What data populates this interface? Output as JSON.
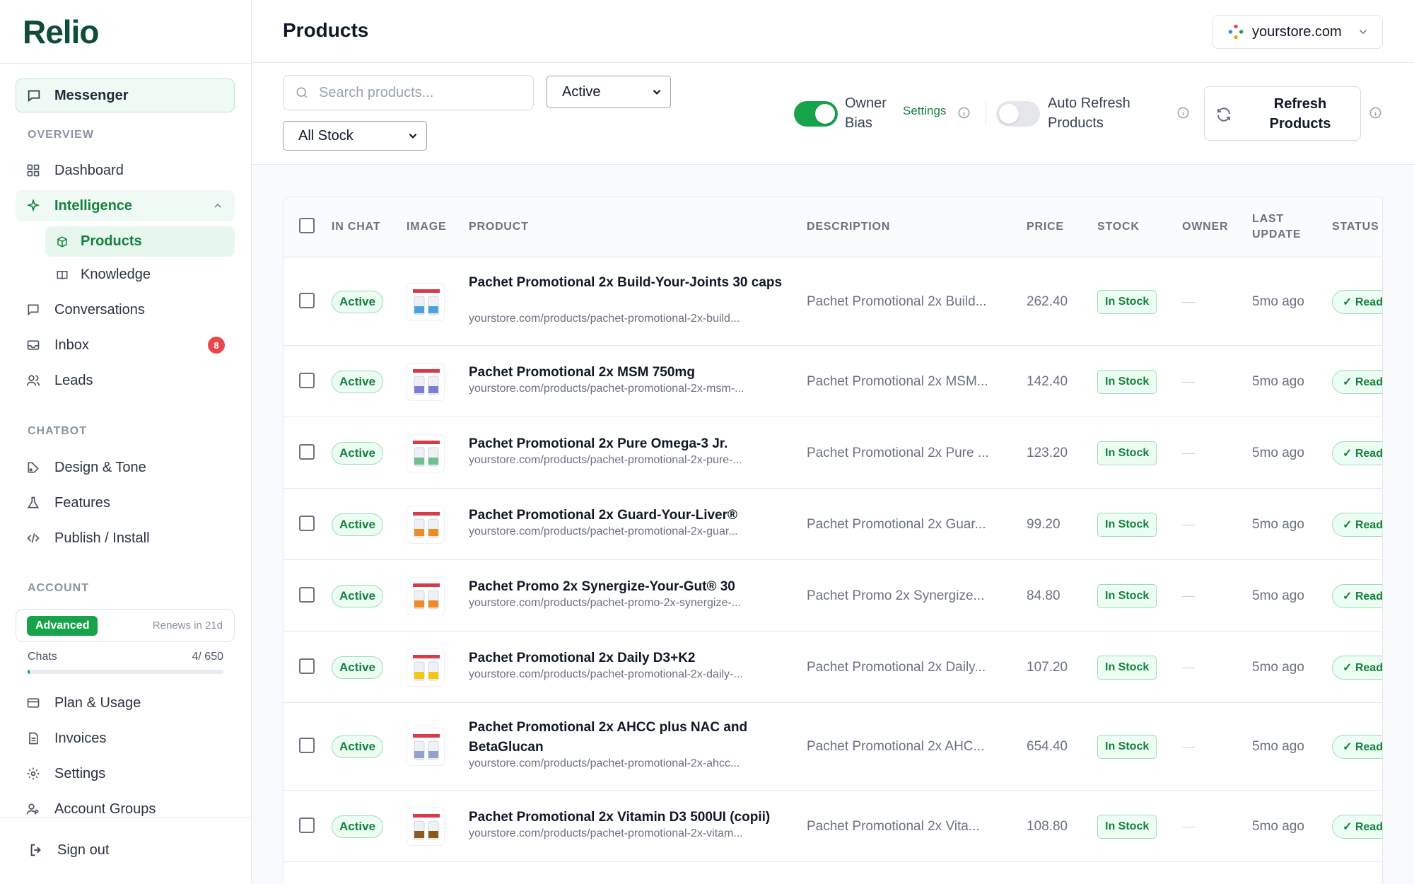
{
  "brand": {
    "logo_text": "Relio",
    "accent": "#16a34a"
  },
  "sidebar": {
    "messenger": "Messenger",
    "overview_label": "OVERVIEW",
    "dashboard": "Dashboard",
    "intelligence": "Intelligence",
    "products": "Products",
    "knowledge": "Knowledge",
    "conversations": "Conversations",
    "inbox": "Inbox",
    "inbox_count": "8",
    "leads": "Leads",
    "chatbot_label": "CHATBOT",
    "design_tone": "Design & Tone",
    "features": "Features",
    "publish_install": "Publish / Install",
    "account_label": "ACCOUNT",
    "plan_name": "Advanced",
    "plan_renew": "Renews in 21d",
    "chats_label": "Chats",
    "chats_value": "4/ 650",
    "chats_fraction": 0.006,
    "plan_usage": "Plan & Usage",
    "invoices": "Invoices",
    "settings": "Settings",
    "account_groups": "Account Groups",
    "sign_out": "Sign out"
  },
  "header": {
    "title": "Products",
    "store": "yourstore.com"
  },
  "toolbar": {
    "search_placeholder": "Search products...",
    "status_filter": "Active",
    "stock_filter": "All Stock",
    "owner_bias_line1": "Owner",
    "owner_bias_line2": "Bias",
    "owner_bias_on": true,
    "settings_link": "Settings",
    "auto_refresh_line1": "Auto Refresh",
    "auto_refresh_line2": "Products",
    "auto_refresh_on": false,
    "refresh_line1": "Refresh",
    "refresh_line2": "Products"
  },
  "table": {
    "headers": {
      "in_chat": "IN CHAT",
      "image": "IMAGE",
      "product": "PRODUCT",
      "description": "DESCRIPTION",
      "price": "PRICE",
      "stock": "STOCK",
      "owner": "OWNER",
      "last_update_1": "LAST",
      "last_update_2": "UPDATE",
      "status": "STATUS"
    },
    "rows": [
      {
        "in_chat": "Active",
        "name": "Pachet Promotional 2x Build-Your-Joints 30 caps",
        "url": "yourstore.com/products/pachet-promotional-2x-build...",
        "description": "Pachet Promotional 2x Build...",
        "price": "262.40",
        "stock": "In Stock",
        "owner": "—",
        "last_update": "5mo ago",
        "status": "✓ Ready"
      },
      {
        "in_chat": "Active",
        "name": "Pachet Promotional 2x MSM 750mg",
        "url": "yourstore.com/products/pachet-promotional-2x-msm-...",
        "description": "Pachet Promotional 2x MSM...",
        "price": "142.40",
        "stock": "In Stock",
        "owner": "—",
        "last_update": "5mo ago",
        "status": "✓ Ready"
      },
      {
        "in_chat": "Active",
        "name": "Pachet Promotional 2x Pure Omega-3 Jr.",
        "url": "yourstore.com/products/pachet-promotional-2x-pure-...",
        "description": "Pachet Promotional 2x Pure ...",
        "price": "123.20",
        "stock": "In Stock",
        "owner": "—",
        "last_update": "5mo ago",
        "status": "✓ Ready"
      },
      {
        "in_chat": "Active",
        "name": "Pachet Promotional 2x Guard-Your-Liver®",
        "url": "yourstore.com/products/pachet-promotional-2x-guar...",
        "description": "Pachet Promotional 2x Guar...",
        "price": "99.20",
        "stock": "In Stock",
        "owner": "—",
        "last_update": "5mo ago",
        "status": "✓ Ready"
      },
      {
        "in_chat": "Active",
        "name": "Pachet Promo 2x Synergize-Your-Gut® 30",
        "url": "yourstore.com/products/pachet-promo-2x-synergize-...",
        "description": "Pachet Promo 2x Synergize...",
        "price": "84.80",
        "stock": "In Stock",
        "owner": "—",
        "last_update": "5mo ago",
        "status": "✓ Ready"
      },
      {
        "in_chat": "Active",
        "name": "Pachet Promotional 2x Daily D3+K2",
        "url": "yourstore.com/products/pachet-promotional-2x-daily-...",
        "description": "Pachet Promotional 2x Daily...",
        "price": "107.20",
        "stock": "In Stock",
        "owner": "—",
        "last_update": "5mo ago",
        "status": "✓ Ready"
      },
      {
        "in_chat": "Active",
        "name": "Pachet Promotional 2x AHCC plus NAC and BetaGlucan",
        "url": "yourstore.com/products/pachet-promotional-2x-ahcc...",
        "description": "Pachet Promotional 2x AHC...",
        "price": "654.40",
        "stock": "In Stock",
        "owner": "—",
        "last_update": "5mo ago",
        "status": "✓ Ready"
      },
      {
        "in_chat": "Active",
        "name": "Pachet Promotional 2x Vitamin D3 500UI (copii)",
        "url": "yourstore.com/products/pachet-promotional-2x-vitam...",
        "description": "Pachet Promotional 2x Vita...",
        "price": "108.80",
        "stock": "In Stock",
        "owner": "—",
        "last_update": "5mo ago",
        "status": "✓ Ready"
      }
    ]
  }
}
